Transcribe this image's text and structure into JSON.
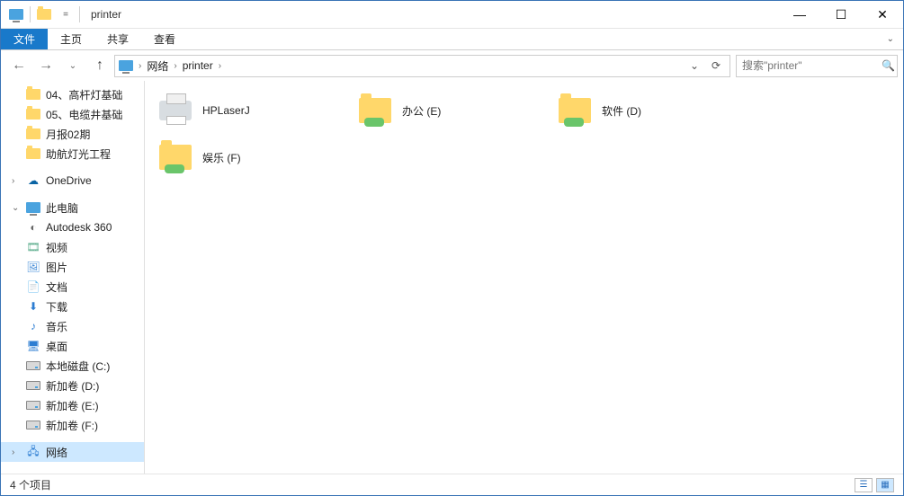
{
  "window": {
    "title": "printer"
  },
  "ribbon": {
    "file": "文件",
    "tabs": [
      "主页",
      "共享",
      "查看"
    ]
  },
  "breadcrumbs": [
    "网络",
    "printer"
  ],
  "addressbar": {
    "dropdown_icon": "chevron-down",
    "refresh_icon": "refresh"
  },
  "search": {
    "placeholder": "搜索\"printer\""
  },
  "sidebar": {
    "recent": [
      {
        "label": "04、高杆灯基础",
        "type": "folder"
      },
      {
        "label": "05、电缆井基础",
        "type": "folder"
      },
      {
        "label": "月报02期",
        "type": "folder"
      },
      {
        "label": "助航灯光工程",
        "type": "folder"
      }
    ],
    "onedrive": "OneDrive",
    "thispc": {
      "label": "此电脑",
      "children": [
        {
          "label": "Autodesk 360",
          "icon": "autodesk"
        },
        {
          "label": "视频",
          "icon": "video"
        },
        {
          "label": "图片",
          "icon": "pictures"
        },
        {
          "label": "文档",
          "icon": "documents"
        },
        {
          "label": "下载",
          "icon": "downloads"
        },
        {
          "label": "音乐",
          "icon": "music"
        },
        {
          "label": "桌面",
          "icon": "desktop"
        },
        {
          "label": "本地磁盘 (C:)",
          "icon": "drive"
        },
        {
          "label": "新加卷 (D:)",
          "icon": "drive"
        },
        {
          "label": "新加卷 (E:)",
          "icon": "drive"
        },
        {
          "label": "新加卷 (F:)",
          "icon": "drive"
        }
      ]
    },
    "network": "网络"
  },
  "items": [
    {
      "name": "HPLaserJ",
      "kind": "printer"
    },
    {
      "name": "办公 (E)",
      "kind": "share"
    },
    {
      "name": "软件 (D)",
      "kind": "share"
    },
    {
      "name": "娱乐 (F)",
      "kind": "share"
    }
  ],
  "status": {
    "count_label": "4 个项目"
  },
  "colors": {
    "accent": "#1979ca",
    "selection": "#cde8ff",
    "folder": "#ffd76a"
  }
}
